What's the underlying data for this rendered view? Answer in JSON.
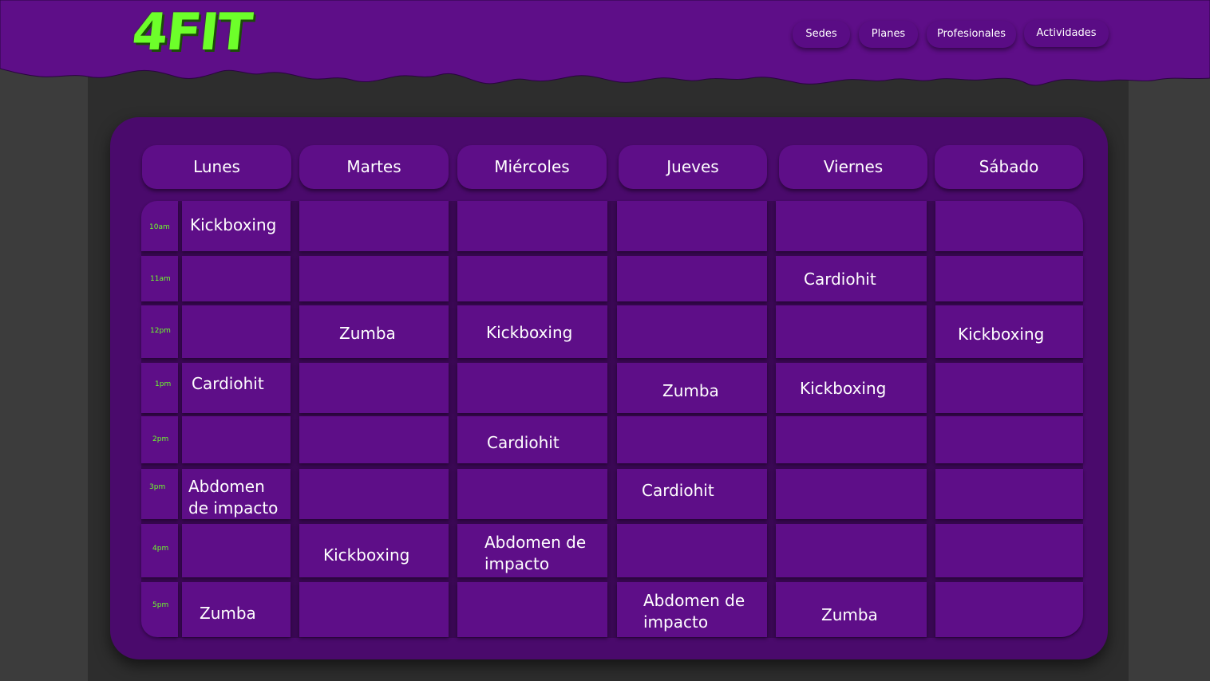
{
  "brand": {
    "logo": "4FIT",
    "colors": {
      "purple": "#5e0e88",
      "green": "#6dff2a"
    }
  },
  "nav": [
    "Sedes",
    "Planes",
    "Profesionales",
    "Actividades"
  ],
  "schedule": {
    "days": [
      "Lunes",
      "Martes",
      "Miércoles",
      "Jueves",
      "Viernes",
      "Sábado"
    ],
    "times": [
      "10am",
      "11am",
      "12pm",
      "1pm",
      "2pm",
      "3pm",
      "4pm",
      "5pm"
    ],
    "rows": [
      [
        "Kickboxing",
        "",
        "",
        "",
        "",
        ""
      ],
      [
        "",
        "",
        "",
        "",
        "Cardiohit",
        ""
      ],
      [
        "",
        "Zumba",
        "Kickboxing",
        "",
        "",
        "Kickboxing"
      ],
      [
        "Cardiohit",
        "",
        "",
        "Zumba",
        "Kickboxing",
        ""
      ],
      [
        "",
        "",
        "Cardiohit",
        "",
        "",
        ""
      ],
      [
        "Abdomen de impacto",
        "",
        "",
        "Cardiohit",
        "",
        ""
      ],
      [
        "",
        "Kickboxing",
        "Abdomen de impacto",
        "",
        "",
        ""
      ],
      [
        "Zumba",
        "",
        "",
        "Abdomen de impacto",
        "Zumba",
        ""
      ]
    ]
  }
}
